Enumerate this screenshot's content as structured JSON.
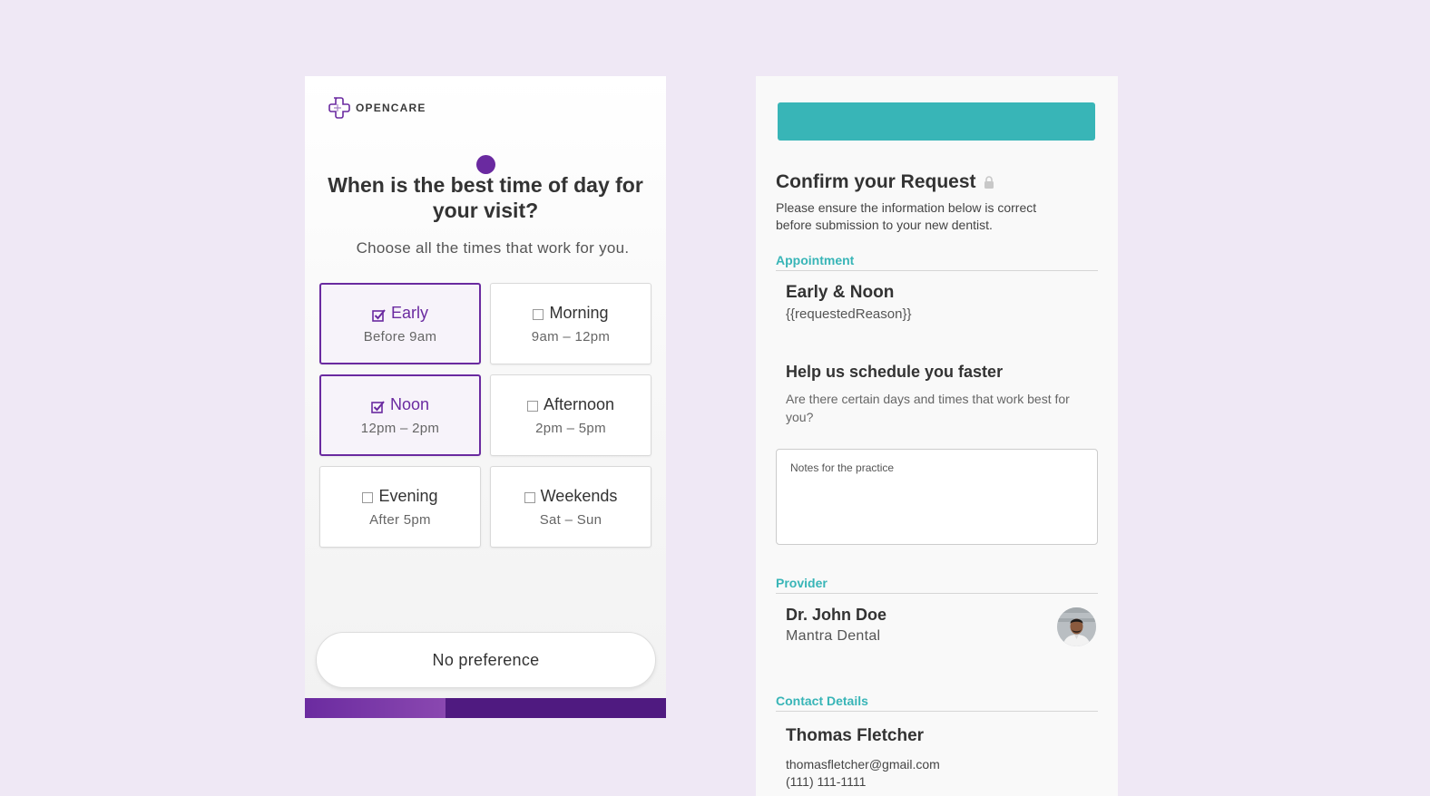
{
  "brand": {
    "name": "OPENCARE"
  },
  "question": {
    "title": "When is the best time of day for your visit?",
    "subtitle": "Choose all the times that work for you."
  },
  "options": [
    {
      "label": "Early",
      "sub": "Before 9am",
      "selected": true
    },
    {
      "label": "Morning",
      "sub": "9am – 12pm",
      "selected": false
    },
    {
      "label": "Noon",
      "sub": "12pm – 2pm",
      "selected": true
    },
    {
      "label": "Afternoon",
      "sub": "2pm – 5pm",
      "selected": false
    },
    {
      "label": "Evening",
      "sub": "After 5pm",
      "selected": false
    },
    {
      "label": "Weekends",
      "sub": "Sat – Sun",
      "selected": false
    }
  ],
  "no_preference_label": "No preference",
  "progress": {
    "fraction": 0.39
  },
  "confirm": {
    "title": "Confirm your Request",
    "description": "Please ensure the information below is correct before submission to your new dentist."
  },
  "appointment": {
    "section_label": "Appointment",
    "title": "Early & Noon",
    "reason": "{{requestedReason}}"
  },
  "help": {
    "title": "Help us schedule you faster",
    "description": "Are there certain days and times that work best for you?",
    "notes_placeholder": "Notes for the practice"
  },
  "provider": {
    "section_label": "Provider",
    "name": "Dr. John Doe",
    "practice": "Mantra Dental"
  },
  "contact": {
    "section_label": "Contact Details",
    "name": "Thomas Fletcher",
    "email": "thomasfletcher@gmail.com",
    "phone": "(111) 111-1111"
  },
  "colors": {
    "accent_purple": "#6a2aa0",
    "accent_teal": "#38b5b7",
    "background": "#efe8f5"
  },
  "icons": {
    "brand": "opencare-cross-icon",
    "lock": "lock-icon",
    "checked": "checkbox-checked-icon",
    "unchecked": "checkbox-unchecked-icon"
  }
}
